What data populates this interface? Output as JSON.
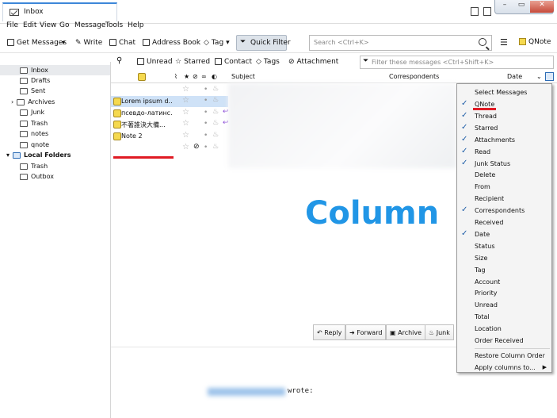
{
  "titlebar": {
    "tab_title": "Inbox",
    "win_min": "–",
    "win_max": "▭",
    "win_close": "✕"
  },
  "menubar": {
    "items": [
      "File",
      "Edit",
      "View",
      "Go",
      "Message",
      "Tools",
      "Help"
    ]
  },
  "toolbar": {
    "get_messages": "Get Messages",
    "write": "Write",
    "chat": "Chat",
    "address_book": "Address Book",
    "tag": "Tag",
    "quick_filter": "Quick Filter",
    "search_placeholder": "Search <Ctrl+K>",
    "qnote": "QNote"
  },
  "filterbar": {
    "unread": "Unread",
    "starred": "Starred",
    "contact": "Contact",
    "tags": "Tags",
    "attachment": "Attachment",
    "filter_placeholder": "Filter these messages <Ctrl+Shift+K>"
  },
  "folders": {
    "inbox": "Inbox",
    "drafts": "Drafts",
    "sent": "Sent",
    "archives": "Archives",
    "junk": "Junk",
    "trash": "Trash",
    "notes": "notes",
    "qnote": "qnote",
    "local_folders": "Local Folders",
    "local_trash": "Trash",
    "outbox": "Outbox"
  },
  "columns": {
    "subject": "Subject",
    "correspondents": "Correspondents",
    "date": "Date"
  },
  "messages": [
    {
      "subject": "Lorem ipsum d..."
    },
    {
      "subject": "псевдо-латинс..."
    },
    {
      "subject": "不著誰決大備..."
    },
    {
      "subject": "Note 2"
    }
  ],
  "overlay_text": "Column",
  "actions": {
    "reply": "Reply",
    "forward": "Forward",
    "archive": "Archive",
    "junk": "Junk"
  },
  "wrote": "wrote:",
  "column_menu": [
    {
      "label": "Select Messages",
      "checked": false
    },
    {
      "label": "QNote",
      "checked": true
    },
    {
      "label": "Thread",
      "checked": true
    },
    {
      "label": "Starred",
      "checked": true
    },
    {
      "label": "Attachments",
      "checked": true
    },
    {
      "label": "Read",
      "checked": true
    },
    {
      "label": "Junk Status",
      "checked": true
    },
    {
      "label": "Delete",
      "checked": false
    },
    {
      "label": "From",
      "checked": false
    },
    {
      "label": "Recipient",
      "checked": false
    },
    {
      "label": "Correspondents",
      "checked": true
    },
    {
      "label": "Received",
      "checked": false
    },
    {
      "label": "Date",
      "checked": true
    },
    {
      "label": "Status",
      "checked": false
    },
    {
      "label": "Size",
      "checked": false
    },
    {
      "label": "Tag",
      "checked": false
    },
    {
      "label": "Account",
      "checked": false
    },
    {
      "label": "Priority",
      "checked": false
    },
    {
      "label": "Unread",
      "checked": false
    },
    {
      "label": "Total",
      "checked": false
    },
    {
      "label": "Location",
      "checked": false
    },
    {
      "label": "Order Received",
      "checked": false
    },
    {
      "label": "Restore Column Order",
      "checked": false
    },
    {
      "label": "Apply columns to...",
      "checked": false
    }
  ],
  "colors": {
    "accent": "#2196e6",
    "highlight_red": "#e01b24",
    "selected_row": "#cfe2f7",
    "check": "#1f5ea8"
  }
}
